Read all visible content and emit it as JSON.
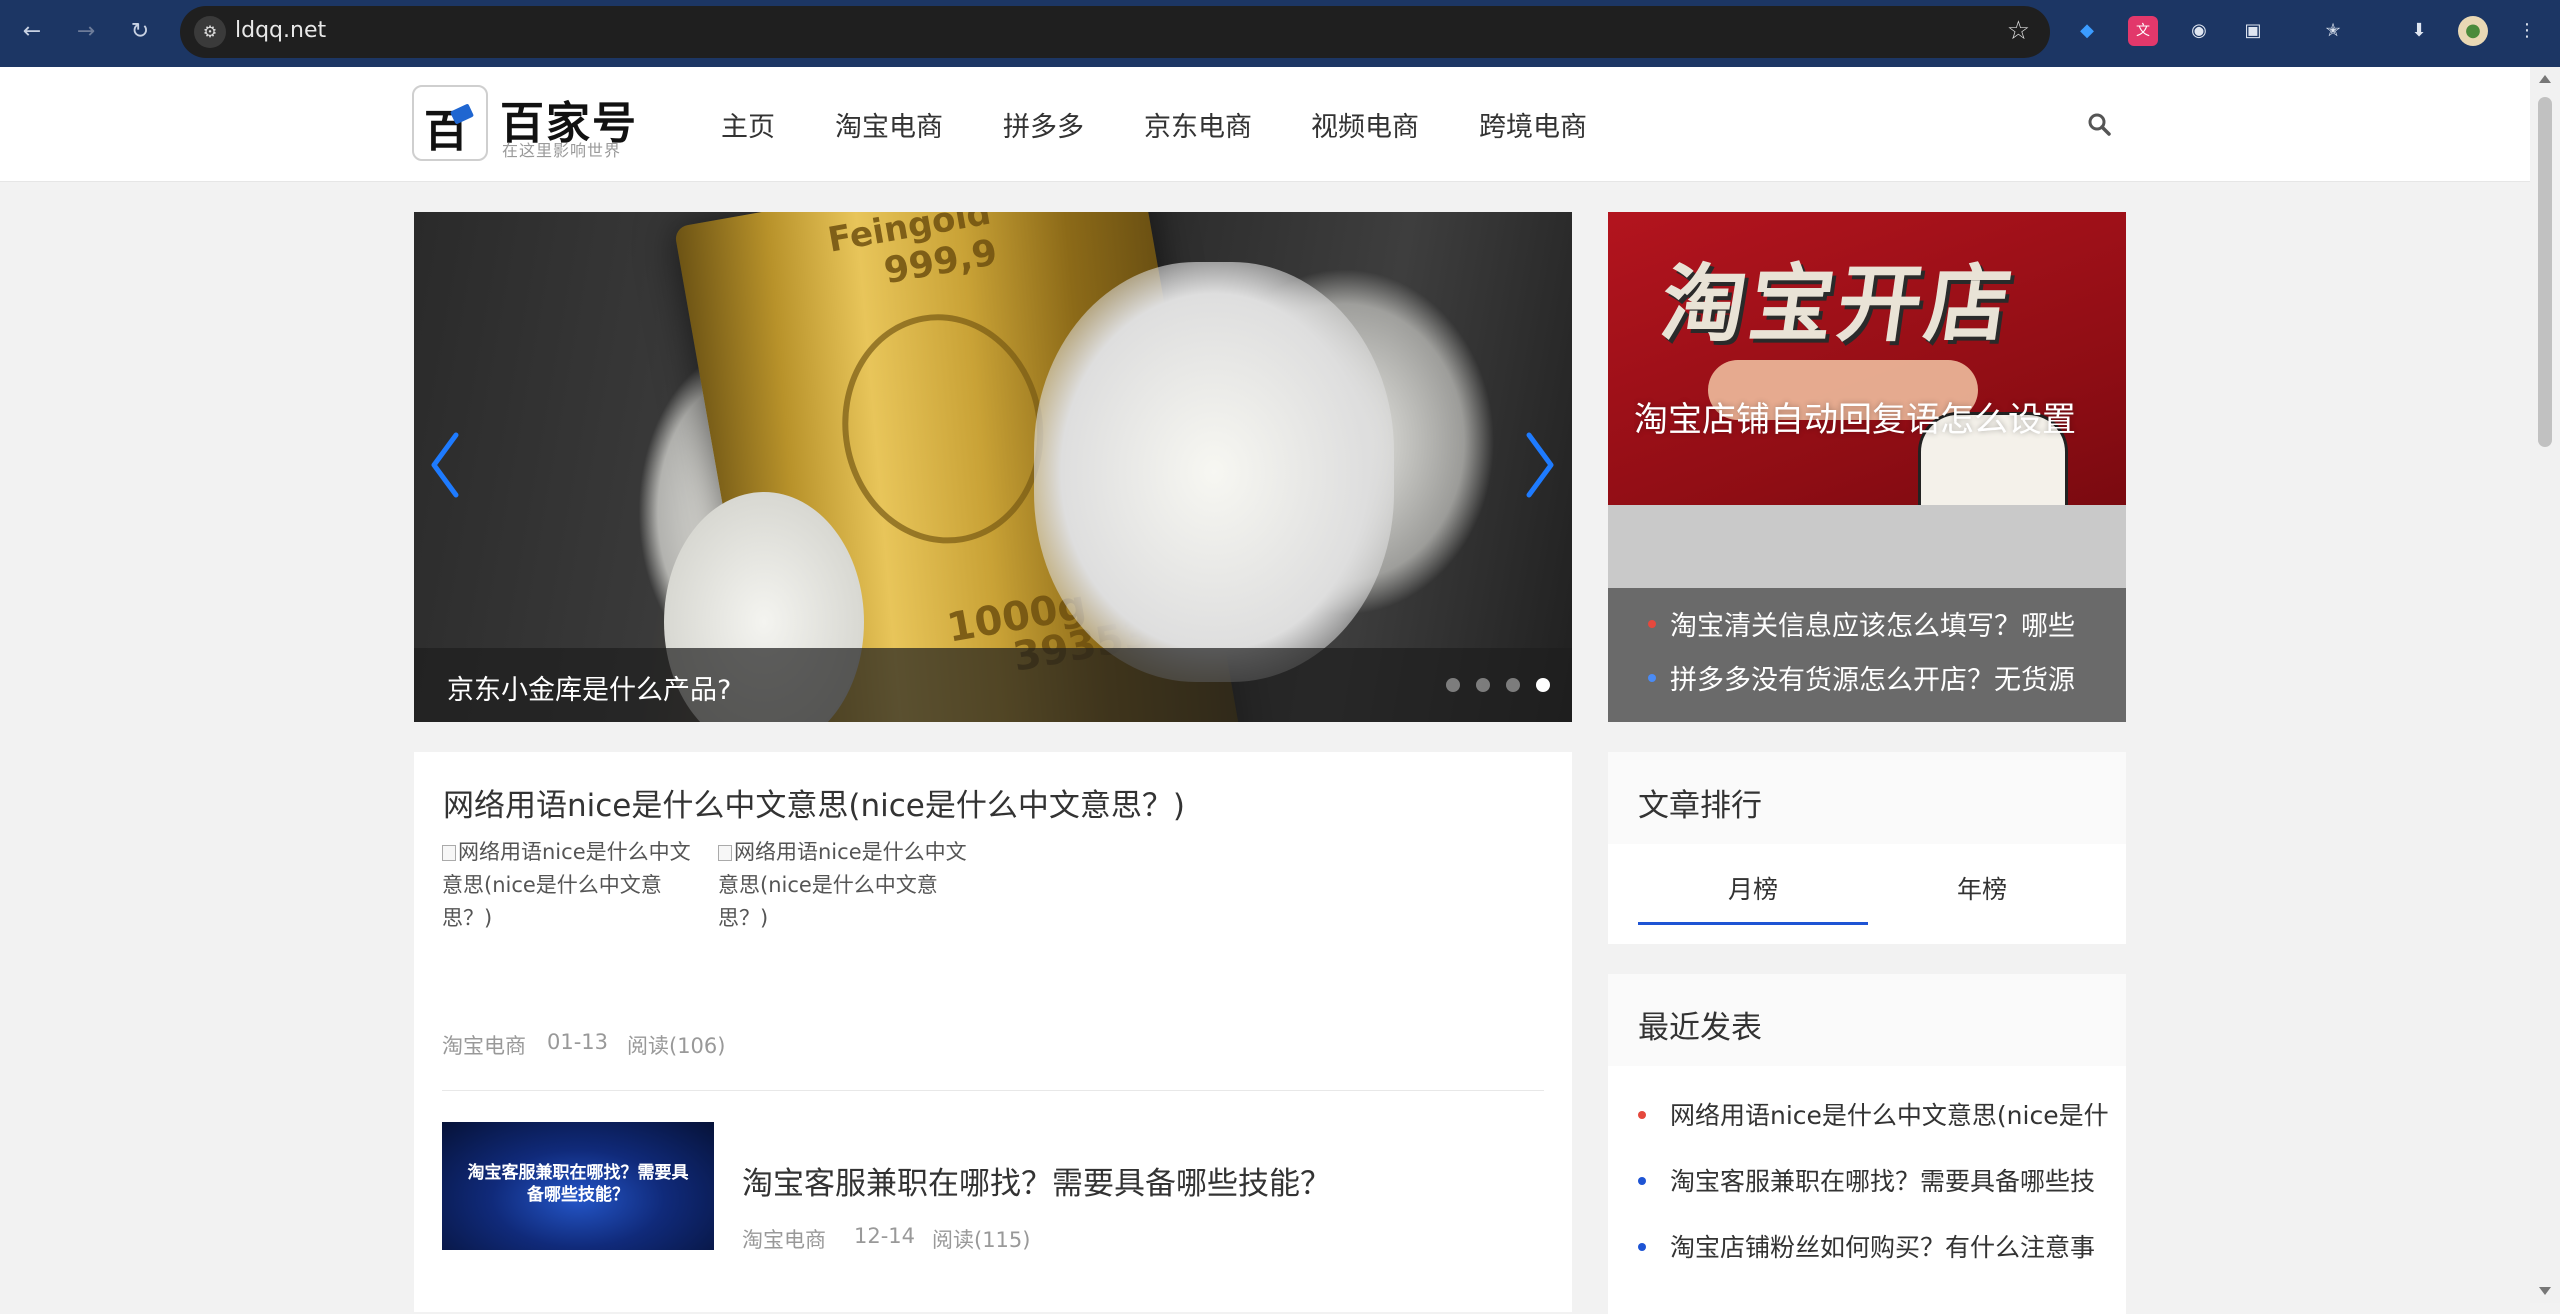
{
  "browser": {
    "url": "ldqq.net"
  },
  "header": {
    "logo_glyph": "百",
    "logo_name": "百家号",
    "logo_slogan": "在这里影响世界",
    "nav": [
      "主页",
      "淘宝电商",
      "拼多多",
      "京东电商",
      "视频电商",
      "跨境电商"
    ]
  },
  "slider": {
    "caption": "京东小金库是什么产品?",
    "bar_text": [
      "Feingold",
      "999,9",
      "1000g",
      "39353"
    ],
    "dots": 4,
    "active_dot": 3
  },
  "side_banner": {
    "image_title": "淘宝开店",
    "image_caption": "淘宝店铺自动回复语怎么设置",
    "list": [
      {
        "text": "淘宝清关信息应该怎么填写？哪些",
        "bullet_color": "#e5483d"
      },
      {
        "text": "拼多多没有货源怎么开店？无货源",
        "bullet_color": "#4a8bf5"
      }
    ]
  },
  "articles": [
    {
      "title": "网络用语nice是什么中文意思(nice是什么中文意思？)",
      "images_alt": [
        "网络用语nice是什么中文意思(nice是什么中文意思？)",
        "网络用语nice是什么中文意思(nice是什么中文意思？)"
      ],
      "category": "淘宝电商",
      "date": "01-13",
      "reads": "阅读(106)"
    },
    {
      "title": "淘宝客服兼职在哪找？需要具备哪些技能？",
      "thumb_text": "淘宝客服兼职在哪找？需要具备哪些技能？",
      "category": "淘宝电商",
      "date": "12-14",
      "reads": "阅读(115)"
    }
  ],
  "rank": {
    "title": "文章排行",
    "tabs": [
      "月榜",
      "年榜"
    ],
    "active_tab": 0,
    "accent": "#1e54d4"
  },
  "recent": {
    "title": "最近发表",
    "items": [
      {
        "text": "网络用语nice是什么中文意思(nice是什",
        "bullet_color": "#e5483d"
      },
      {
        "text": "淘宝客服兼职在哪找？需要具备哪些技",
        "bullet_color": "#1e54d4"
      },
      {
        "text": "淘宝店铺粉丝如何购买？有什么注意事",
        "bullet_color": "#1e54d4"
      }
    ]
  },
  "icons": {
    "back": "arrow-left-icon",
    "forward": "arrow-right-icon",
    "reload": "reload-icon",
    "search": "search-icon",
    "star": "star-icon"
  }
}
